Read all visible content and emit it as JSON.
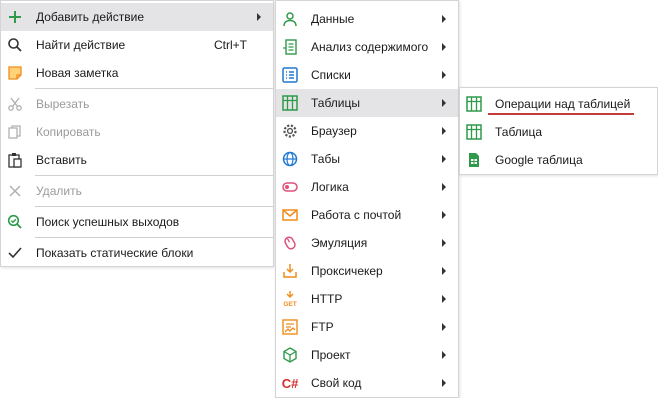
{
  "menu_main": {
    "add_action": "Добавить действие",
    "find_action": "Найти действие",
    "find_shortcut": "Ctrl+T",
    "new_note": "Новая заметка",
    "cut": "Вырезать",
    "copy": "Копировать",
    "paste": "Вставить",
    "delete": "Удалить",
    "search_success": "Поиск успешных выходов",
    "show_static": "Показать статические блоки"
  },
  "menu_actions": {
    "data": "Данные",
    "content_analysis": "Анализ содержимого",
    "lists": "Списки",
    "tables": "Таблицы",
    "browser": "Браузер",
    "tabs": "Табы",
    "logic": "Логика",
    "email": "Работа с почтой",
    "emulation": "Эмуляция",
    "proxy_checker": "Проксичекер",
    "http": "HTTP",
    "ftp": "FTP",
    "project": "Проект",
    "custom_code": "Свой код"
  },
  "menu_tables": {
    "table_ops": "Операции над таблицей",
    "table": "Таблица",
    "google_table": "Google таблица"
  },
  "icons": {
    "http_glyph": "GET",
    "code_glyph": "C#"
  },
  "colors": {
    "highlight": "#e4e4e6",
    "green": "#2e9a4a",
    "blue": "#1f78d1",
    "orange": "#f08c1a",
    "pink": "#e0507a",
    "underline_red": "#c43c3c"
  }
}
